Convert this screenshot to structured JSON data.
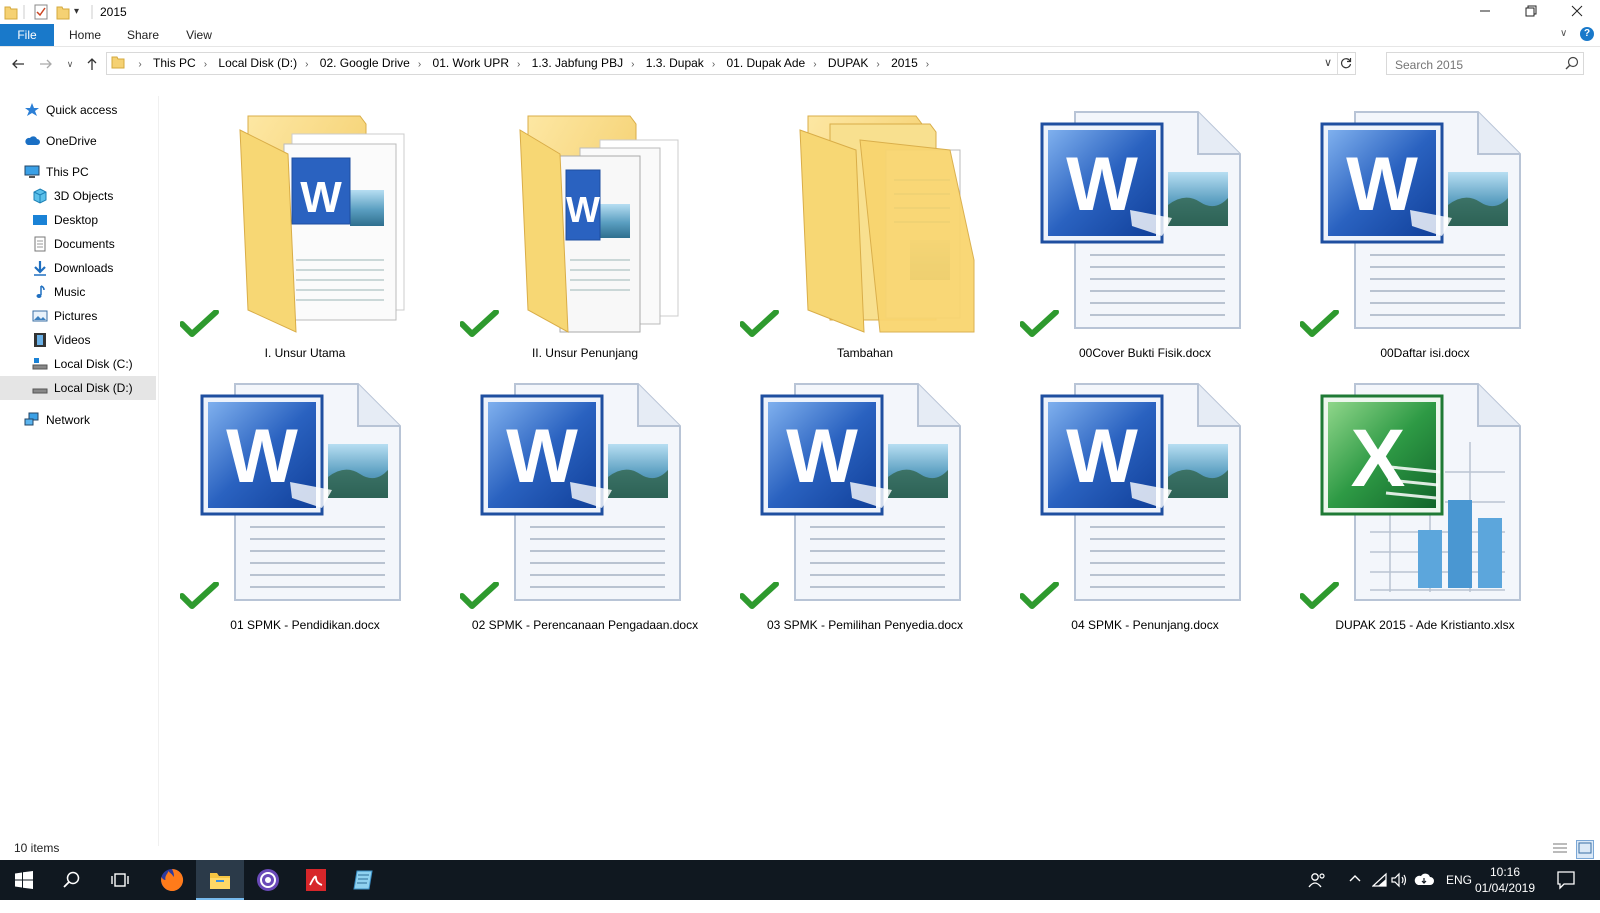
{
  "window": {
    "title": "2015",
    "minimize": "—",
    "maximize": "❐",
    "close": "✕"
  },
  "ribbon": {
    "tabs": [
      {
        "label": "File"
      },
      {
        "label": "Home"
      },
      {
        "label": "Share"
      },
      {
        "label": "View"
      }
    ]
  },
  "address": {
    "crumbs": [
      "This PC",
      "Local Disk (D:)",
      "02. Google Drive",
      "01. Work UPR",
      "1.3. Jabfung PBJ",
      "1.3. Dupak",
      "01. Dupak Ade",
      "DUPAK",
      "2015"
    ]
  },
  "search": {
    "placeholder": "Search 2015"
  },
  "sidebar": {
    "items": [
      {
        "label": "Quick access",
        "icon": "star-icon"
      },
      {
        "label": "OneDrive",
        "icon": "cloud-icon"
      },
      {
        "label": "This PC",
        "icon": "computer-icon"
      },
      {
        "label": "3D Objects",
        "icon": "cube-icon"
      },
      {
        "label": "Desktop",
        "icon": "desktop-icon"
      },
      {
        "label": "Documents",
        "icon": "document-icon"
      },
      {
        "label": "Downloads",
        "icon": "download-arrow-icon"
      },
      {
        "label": "Music",
        "icon": "music-note-icon"
      },
      {
        "label": "Pictures",
        "icon": "picture-icon"
      },
      {
        "label": "Videos",
        "icon": "film-icon"
      },
      {
        "label": "Local Disk (C:)",
        "icon": "drive-icon"
      },
      {
        "label": "Local Disk (D:)",
        "icon": "drive-icon",
        "selected": true
      },
      {
        "label": "Network",
        "icon": "network-icon"
      }
    ]
  },
  "files": [
    {
      "name": "I. Unsur Utama",
      "type": "folder-docs"
    },
    {
      "name": "II. Unsur Penunjang",
      "type": "folder-multi"
    },
    {
      "name": "Tambahan",
      "type": "folder-empty"
    },
    {
      "name": "00Cover Bukti Fisik.docx",
      "type": "word"
    },
    {
      "name": "00Daftar isi.docx",
      "type": "word"
    },
    {
      "name": "01 SPMK - Pendidikan.docx",
      "type": "word"
    },
    {
      "name": "02 SPMK - Perencanaan Pengadaan.docx",
      "type": "word"
    },
    {
      "name": "03 SPMK - Pemilihan Penyedia.docx",
      "type": "word"
    },
    {
      "name": "04 SPMK - Penunjang.docx",
      "type": "word"
    },
    {
      "name": "DUPAK 2015 - Ade Kristianto.xlsx",
      "type": "excel"
    }
  ],
  "status": {
    "count": "10 items"
  },
  "taskbar": {
    "lang": "ENG",
    "time": "10:16",
    "date": "01/04/2019"
  },
  "colors": {
    "accent": "#1979ca",
    "sync_check": "#2e9a2e",
    "word_blue": "#1f4fa0",
    "excel_green": "#1f7a35",
    "folder_yellow": "#f5d173"
  }
}
